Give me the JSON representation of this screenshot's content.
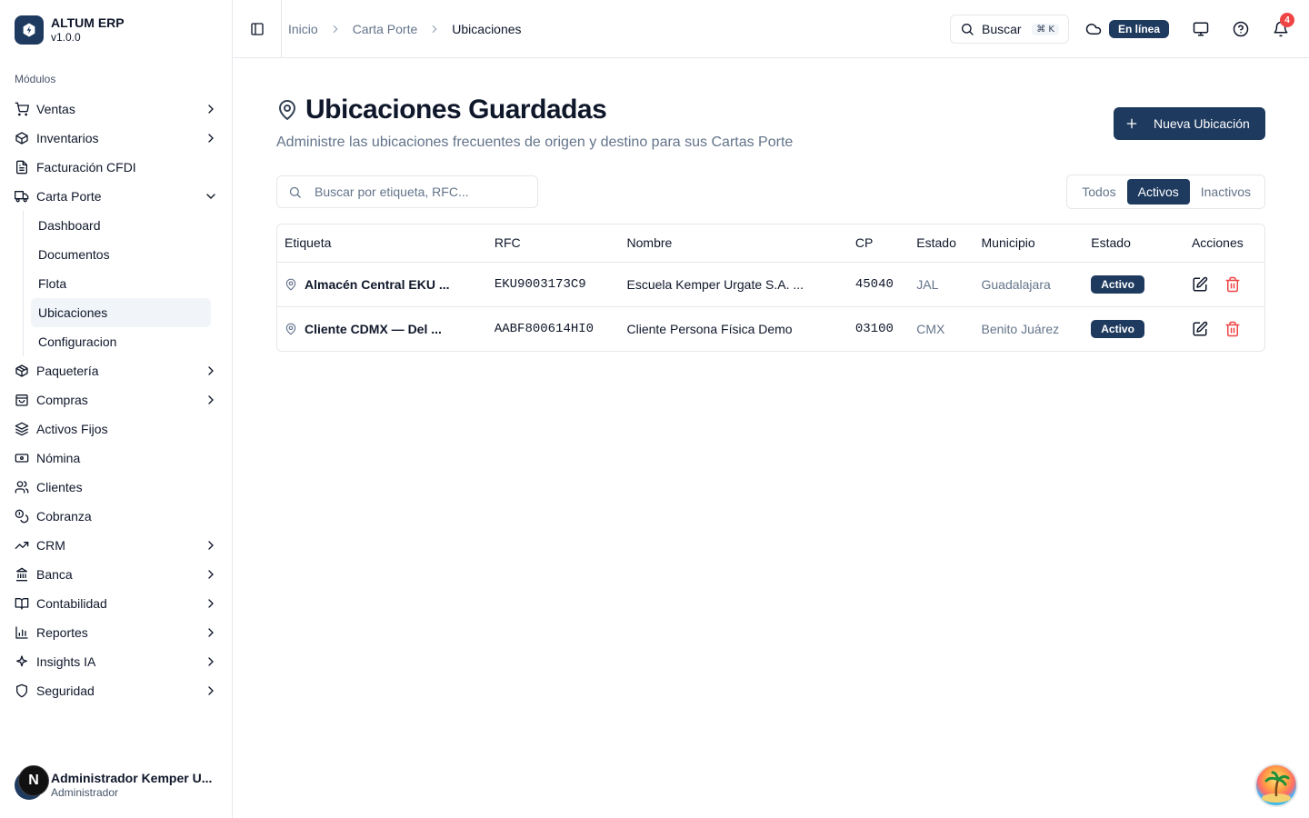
{
  "app": {
    "name": "ALTUM ERP",
    "version": "v1.0.0"
  },
  "sidebar": {
    "section_label": "Módulos",
    "items": [
      {
        "label": "Ventas",
        "icon": "cart-icon",
        "chevron": true
      },
      {
        "label": "Inventarios",
        "icon": "package-icon",
        "chevron": true
      },
      {
        "label": "Facturación CFDI",
        "icon": "document-icon",
        "chevron": false
      },
      {
        "label": "Carta Porte",
        "icon": "truck-icon",
        "chevron": true,
        "expanded": true
      },
      {
        "label": "Paquetería",
        "icon": "package-icon",
        "chevron": true
      },
      {
        "label": "Compras",
        "icon": "shopping-bag-icon",
        "chevron": true
      },
      {
        "label": "Activos Fijos",
        "icon": "layers-icon",
        "chevron": false
      },
      {
        "label": "Nómina",
        "icon": "wallet-icon",
        "chevron": false
      },
      {
        "label": "Clientes",
        "icon": "users-icon",
        "chevron": false
      },
      {
        "label": "Cobranza",
        "icon": "coins-icon",
        "chevron": false
      },
      {
        "label": "CRM",
        "icon": "trending-up-icon",
        "chevron": true
      },
      {
        "label": "Banca",
        "icon": "bank-icon",
        "chevron": true
      },
      {
        "label": "Contabilidad",
        "icon": "book-icon",
        "chevron": true
      },
      {
        "label": "Reportes",
        "icon": "bar-chart-icon",
        "chevron": true
      },
      {
        "label": "Insights IA",
        "icon": "sparkle-icon",
        "chevron": true
      },
      {
        "label": "Seguridad",
        "icon": "shield-icon",
        "chevron": true
      }
    ],
    "carta_porte_sub": [
      "Dashboard",
      "Documentos",
      "Flota",
      "Ubicaciones",
      "Configuracion"
    ],
    "active_sub": "Ubicaciones"
  },
  "user": {
    "initial": "N",
    "name": "Administrador Kemper U...",
    "role": "Administrador"
  },
  "header": {
    "breadcrumbs": [
      "Inicio",
      "Carta Porte",
      "Ubicaciones"
    ],
    "search_label": "Buscar",
    "search_kbd": "⌘ K",
    "status": "En línea",
    "notifications": "4"
  },
  "page": {
    "title": "Ubicaciones Guardadas",
    "subtitle": "Administre las ubicaciones frecuentes de origen y destino para sus Cartas Porte",
    "new_button": "Nueva Ubicación",
    "search_placeholder": "Buscar por etiqueta, RFC...",
    "filters": [
      "Todos",
      "Activos",
      "Inactivos"
    ],
    "active_filter": "Activos"
  },
  "table": {
    "columns": [
      "Etiqueta",
      "RFC",
      "Nombre",
      "CP",
      "Estado",
      "Municipio",
      "Estado",
      "Acciones"
    ],
    "rows": [
      {
        "etiqueta": "Almacén Central EKU ...",
        "rfc": "EKU9003173C9",
        "nombre": "Escuela Kemper Urgate S.A. ...",
        "cp": "45040",
        "estado": "JAL",
        "municipio": "Guadalajara",
        "status": "Activo"
      },
      {
        "etiqueta": "Cliente CDMX — Del ...",
        "rfc": "AABF800614HI0",
        "nombre": "Cliente Persona Física Demo",
        "cp": "03100",
        "estado": "CMX",
        "municipio": "Benito Juárez",
        "status": "Activo"
      }
    ]
  },
  "colors": {
    "primary": "#1e3a5f",
    "danger": "#ef4444",
    "muted": "#64748b",
    "border": "#e5e7eb"
  }
}
